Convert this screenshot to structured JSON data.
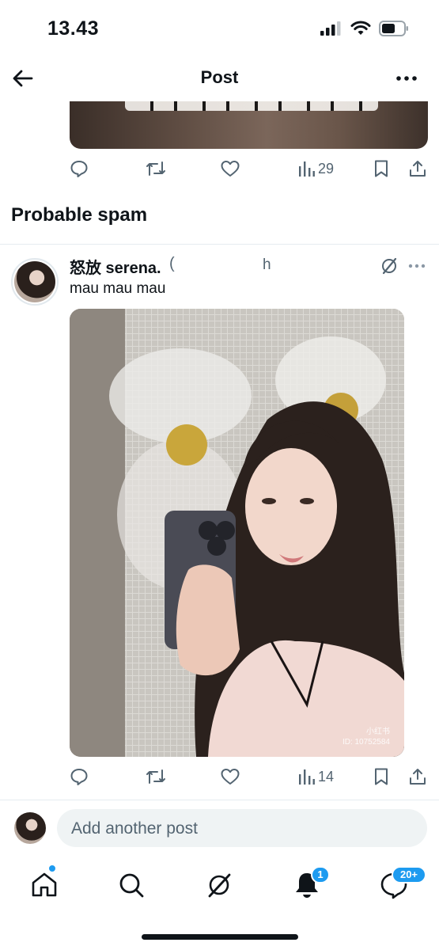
{
  "status": {
    "time": "13.43"
  },
  "nav": {
    "title": "Post"
  },
  "prev_post": {
    "views": "29"
  },
  "section": {
    "title": "Probable spam"
  },
  "post": {
    "author_name": "怒放 serena.",
    "handle_fragment": "(",
    "timestamp": "h",
    "text": "mau mau mau",
    "views": "14",
    "media_watermark": "小红书",
    "media_id": "ID: 10752584"
  },
  "reply": {
    "placeholder": "Add another post"
  },
  "tabs": {
    "notifications_badge": "1",
    "messages_badge": "20+"
  },
  "icons": {
    "status": [
      "signal-icon",
      "wifi-icon",
      "battery-icon"
    ],
    "nav": [
      "back-arrow-icon",
      "more-icon"
    ],
    "actions": [
      "reply-icon",
      "repost-icon",
      "like-icon",
      "views-icon",
      "bookmark-icon",
      "share-icon"
    ],
    "tabs": [
      "home-icon",
      "search-icon",
      "grok-icon",
      "notifications-icon",
      "messages-icon"
    ]
  },
  "colors": {
    "accent": "#1d9bf0",
    "text": "#0f1419",
    "secondary": "#536471",
    "input_bg": "#eff3f4"
  }
}
